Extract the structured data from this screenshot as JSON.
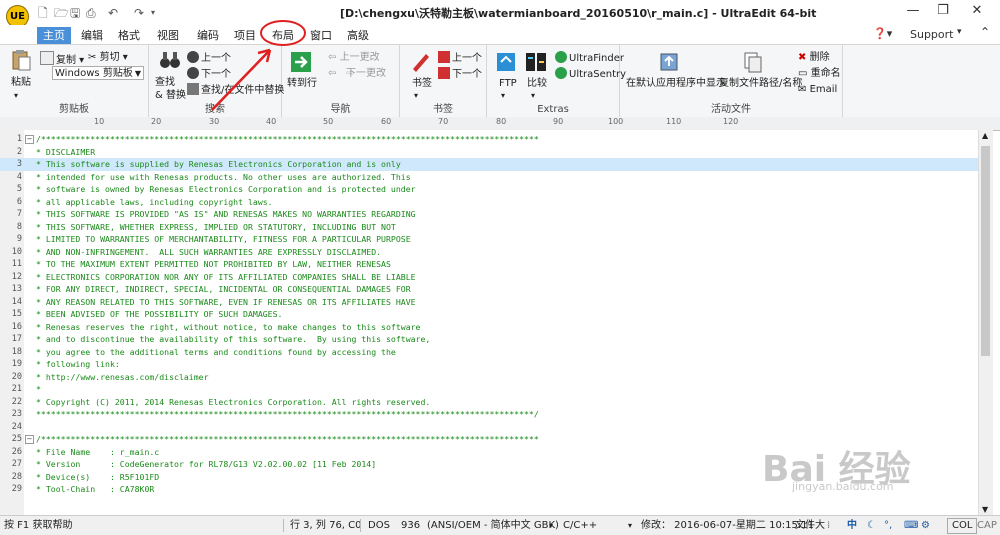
{
  "window": {
    "title": "[D:\\chengxu\\沃特勒主板\\watermianboard_20160510\\r_main.c] - UltraEdit 64-bit",
    "logo_text": "UE"
  },
  "tabs": [
    "主页",
    "编辑",
    "格式",
    "视图",
    "编码",
    "项目",
    "布局",
    "窗口",
    "高级"
  ],
  "active_tab": "主页",
  "help": {
    "support_label": "Support"
  },
  "ribbon": {
    "clipboard": {
      "label": "剪贴板",
      "paste": "粘贴",
      "copy": "复制",
      "cut": "剪切",
      "clipboard_select": "Windows 剪贴板"
    },
    "search": {
      "label": "搜索",
      "find_replace": "查找\n& 替换",
      "prev": "上一个",
      "next": "下一个",
      "find_in_files": "查找/在文件中替换"
    },
    "navigation": {
      "label": "导航",
      "goto": "转到行",
      "prev_change": "上一更改",
      "next_change": "下一更改"
    },
    "bookmarks": {
      "label": "书签",
      "bookmark": "书签",
      "prev": "上一个",
      "next": "下一个"
    },
    "extras": {
      "label": "Extras",
      "ftp": "FTP",
      "compare": "比较",
      "ultrafinder": "UltraFinder",
      "ultrasentry": "UltraSentry"
    },
    "active_file": {
      "label": "活动文件",
      "open_default": "在默认应用程序中显示",
      "copy_path": "复制文件路径/名称",
      "delete": "删除",
      "rename": "重命名",
      "email": "Email"
    }
  },
  "ruler": {
    "ticks": [
      "10",
      "20",
      "30",
      "40",
      "50",
      "60",
      "70",
      "80",
      "90",
      "100",
      "110",
      "120"
    ]
  },
  "editor": {
    "highlighted_line": 3,
    "lines": [
      {
        "n": "1",
        "text": "/*****************************************************************************************************",
        "fold": true
      },
      {
        "n": "2",
        "text": "* DISCLAIMER"
      },
      {
        "n": "3",
        "text": "* This software is supplied by Renesas Electronics Corporation and is only"
      },
      {
        "n": "4",
        "text": "* intended for use with Renesas products. No other uses are authorized. This"
      },
      {
        "n": "5",
        "text": "* software is owned by Renesas Electronics Corporation and is protected under"
      },
      {
        "n": "6",
        "text": "* all applicable laws, including copyright laws."
      },
      {
        "n": "7",
        "text": "* THIS SOFTWARE IS PROVIDED \"AS IS\" AND RENESAS MAKES NO WARRANTIES REGARDING"
      },
      {
        "n": "8",
        "text": "* THIS SOFTWARE, WHETHER EXPRESS, IMPLIED OR STATUTORY, INCLUDING BUT NOT"
      },
      {
        "n": "9",
        "text": "* LIMITED TO WARRANTIES OF MERCHANTABILITY, FITNESS FOR A PARTICULAR PURPOSE"
      },
      {
        "n": "10",
        "text": "* AND NON-INFRINGEMENT.  ALL SUCH WARRANTIES ARE EXPRESSLY DISCLAIMED."
      },
      {
        "n": "11",
        "text": "* TO THE MAXIMUM EXTENT PERMITTED NOT PROHIBITED BY LAW, NEITHER RENESAS"
      },
      {
        "n": "12",
        "text": "* ELECTRONICS CORPORATION NOR ANY OF ITS AFFILIATED COMPANIES SHALL BE LIABLE"
      },
      {
        "n": "13",
        "text": "* FOR ANY DIRECT, INDIRECT, SPECIAL, INCIDENTAL OR CONSEQUENTIAL DAMAGES FOR"
      },
      {
        "n": "14",
        "text": "* ANY REASON RELATED TO THIS SOFTWARE, EVEN IF RENESAS OR ITS AFFILIATES HAVE"
      },
      {
        "n": "15",
        "text": "* BEEN ADVISED OF THE POSSIBILITY OF SUCH DAMAGES."
      },
      {
        "n": "16",
        "text": "* Renesas reserves the right, without notice, to make changes to this software"
      },
      {
        "n": "17",
        "text": "* and to discontinue the availability of this software.  By using this software,"
      },
      {
        "n": "18",
        "text": "* you agree to the additional terms and conditions found by accessing the"
      },
      {
        "n": "19",
        "text": "* following link:"
      },
      {
        "n": "20",
        "text": "* http://www.renesas.com/disclaimer"
      },
      {
        "n": "21",
        "text": "*"
      },
      {
        "n": "22",
        "text": "* Copyright (C) 2011, 2014 Renesas Electronics Corporation. All rights reserved."
      },
      {
        "n": "23",
        "text": "*****************************************************************************************************/"
      },
      {
        "n": "24",
        "text": ""
      },
      {
        "n": "25",
        "text": "/*****************************************************************************************************",
        "fold": true
      },
      {
        "n": "26",
        "text": "* File Name    : r_main.c"
      },
      {
        "n": "27",
        "text": "* Version      : CodeGenerator for RL78/G13 V2.02.00.02 [11 Feb 2014]"
      },
      {
        "n": "28",
        "text": "* Device(s)    : R5F101FD"
      },
      {
        "n": "29",
        "text": "* Tool-Chain   : CA78K0R"
      }
    ]
  },
  "status_bar": {
    "help": "按 F1 获取帮助",
    "position": "行 3, 列 76, C0",
    "line_ending": "DOS",
    "codepage": "936",
    "encoding": "(ANSI/OEM - 简体中文 GBK)",
    "language": "C/C++",
    "modified": "修改： 2016-06-07-星期二 10:15:11",
    "file_size": "文件大",
    "col": "COL",
    "cap": "CAP",
    "ime_zh": "中"
  },
  "watermark": {
    "main": "Bai 经验",
    "sub": "jingyan.baidu.com"
  },
  "colors": {
    "accent": "#4a90d9",
    "code_comment": "#1a8a1a",
    "highlight_line": "#cfe8fb",
    "annotation": "#e02020"
  }
}
